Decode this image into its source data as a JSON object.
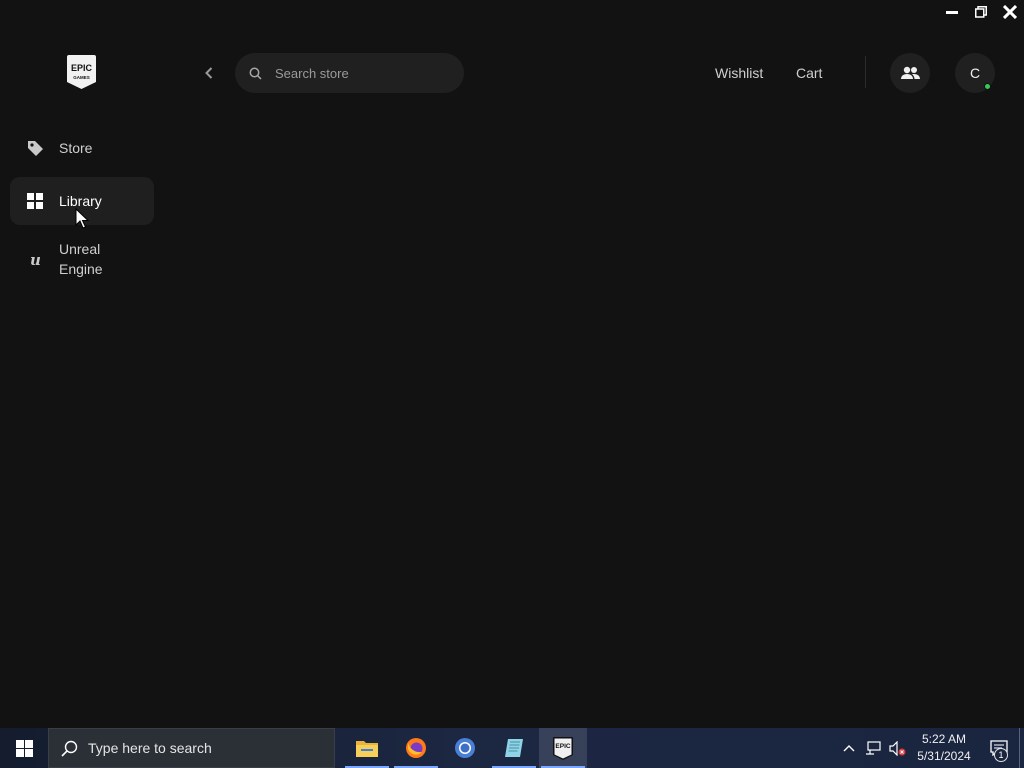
{
  "window": {
    "controls": [
      "minimize-icon",
      "restore-icon",
      "close-icon"
    ]
  },
  "brand": {
    "logo_text_top": "EPIC",
    "logo_text_bottom": "GAMES"
  },
  "sidebar": {
    "items": [
      {
        "label": "Store",
        "icon": "tag-icon",
        "active": false
      },
      {
        "label": "Library",
        "icon": "grid-icon",
        "active": true
      },
      {
        "label": "Unreal Engine",
        "icon": "unreal-engine-icon",
        "active": false
      }
    ]
  },
  "header": {
    "search_placeholder": "Search store",
    "wishlist_label": "Wishlist",
    "cart_label": "Cart",
    "friends_icon": "friends-icon",
    "avatar_letter": "C",
    "status_color": "#35c95a"
  },
  "taskbar": {
    "search_placeholder": "Type here to search",
    "apps": [
      "file-explorer-icon",
      "firefox-icon",
      "chrome-icon",
      "notepad-icon",
      "epic-games-icon"
    ],
    "active_app": "epic-games-icon",
    "time": "5:22 AM",
    "date": "5/31/2024",
    "notification_count": "1"
  },
  "colors": {
    "background": "#121212",
    "panel": "#202020",
    "accent": "#35c95a"
  }
}
